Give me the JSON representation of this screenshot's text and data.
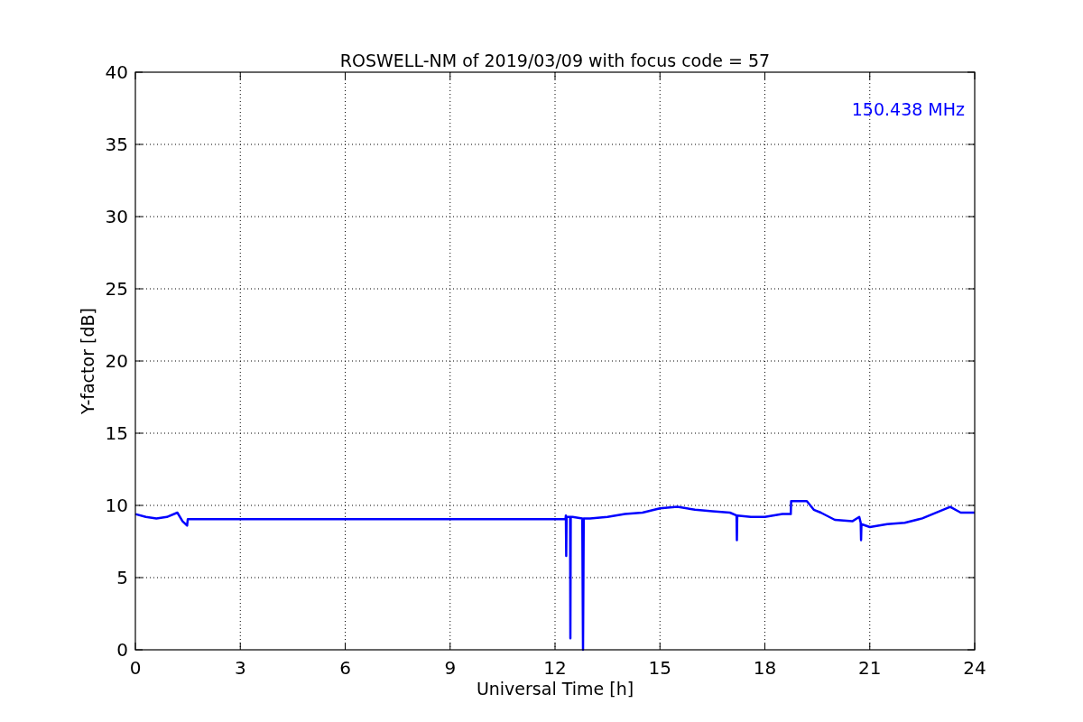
{
  "chart_data": {
    "type": "line",
    "title": "ROSWELL-NM of 2019/03/09 with focus code = 57",
    "xlabel": "Universal Time [h]",
    "ylabel": "Y-factor [dB]",
    "x": [
      0,
      0.3,
      0.6,
      0.9,
      1.2,
      1.35,
      1.48,
      1.5,
      12.3,
      12.31,
      12.32,
      12.33,
      12.43,
      12.44,
      12.45,
      12.5,
      12.78,
      12.8,
      12.82,
      13,
      13.5,
      14,
      14.5,
      15,
      15.5,
      16,
      16.5,
      17,
      17.19,
      17.2,
      17.21,
      17.6,
      18,
      18.5,
      18.74,
      18.75,
      19.2,
      19.4,
      19.6,
      20,
      20.5,
      20.7,
      20.74,
      20.75,
      20.76,
      21,
      21.5,
      22,
      22.5,
      23,
      23.3,
      23.6,
      24
    ],
    "series": [
      {
        "color": "#0000ff",
        "values": [
          9.4,
          9.2,
          9.1,
          9.2,
          9.5,
          8.9,
          8.6,
          9.05,
          9.05,
          9.3,
          6.5,
          9.2,
          9.2,
          0.8,
          9.2,
          9.2,
          9.1,
          0,
          9.1,
          9.1,
          9.2,
          9.4,
          9.5,
          9.8,
          9.9,
          9.7,
          9.6,
          9.5,
          9.3,
          7.6,
          9.3,
          9.2,
          9.2,
          9.4,
          9.4,
          10.3,
          10.3,
          9.7,
          9.5,
          9.0,
          8.9,
          9.2,
          8.8,
          7.6,
          8.7,
          8.5,
          8.7,
          8.8,
          9.1,
          9.6,
          9.9,
          9.5,
          9.5
        ]
      }
    ],
    "xlim": [
      0,
      24
    ],
    "ylim": [
      0,
      40
    ],
    "xticks": [
      0,
      3,
      6,
      9,
      12,
      15,
      18,
      21,
      24
    ],
    "yticks": [
      0,
      5,
      10,
      15,
      20,
      25,
      30,
      35,
      40
    ],
    "grid": true,
    "annotations": [
      {
        "text": "150.438 MHz"
      }
    ]
  }
}
